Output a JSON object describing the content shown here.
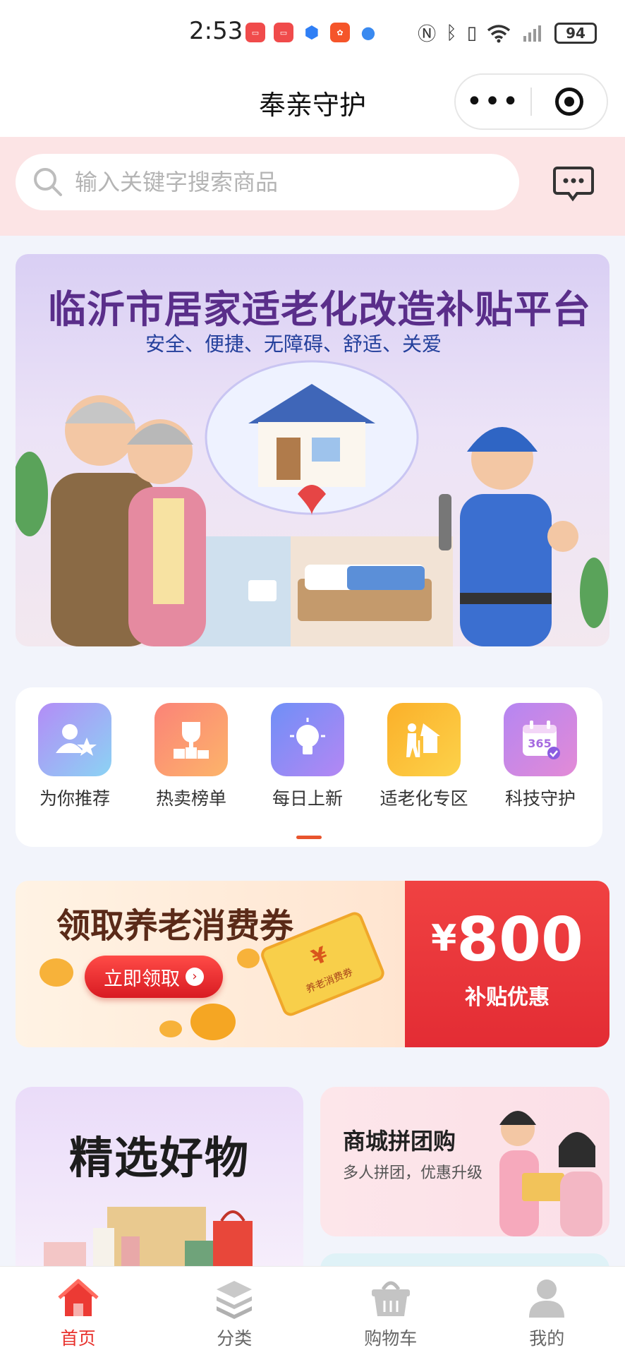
{
  "status_bar": {
    "time": "2:53",
    "battery": "94"
  },
  "nav": {
    "title": "奉亲守护",
    "more_label": "•••"
  },
  "search": {
    "placeholder": "输入关键字搜索商品"
  },
  "banner": {
    "title": "临沂市居家适老化改造补贴平台",
    "subtitle": "安全、便捷、无障碍、舒适、关爱"
  },
  "categories": [
    {
      "label": "为你推荐",
      "icon": "user-star-icon",
      "color": "#b48cf5"
    },
    {
      "label": "热卖榜单",
      "icon": "trophy-icon",
      "color": "#fb7f6f"
    },
    {
      "label": "每日上新",
      "icon": "lightbulb-icon",
      "color": "#7a8af8"
    },
    {
      "label": "适老化专区",
      "icon": "elder-house-icon",
      "color": "#fbb02a"
    },
    {
      "label": "科技守护",
      "icon": "calendar-365-icon",
      "color": "#c383ec"
    }
  ],
  "voucher": {
    "title": "领取养老消费券",
    "button_label": "立即领取",
    "ticket_text": "养老消费券",
    "amount": "800",
    "currency": "¥",
    "subtitle": "补贴优惠"
  },
  "cards": {
    "left_title": "精选好物",
    "right_title": "商城拼团购",
    "right_subtitle": "多人拼团，优惠升级"
  },
  "tabs": [
    {
      "label": "首页",
      "icon": "home-icon",
      "active": true
    },
    {
      "label": "分类",
      "icon": "layers-icon",
      "active": false
    },
    {
      "label": "购物车",
      "icon": "cart-basket-icon",
      "active": false
    },
    {
      "label": "我的",
      "icon": "person-icon",
      "active": false
    }
  ],
  "colors": {
    "accent": "#e8322d",
    "voucher_red": "#ef3c3f",
    "search_band": "#fce4e5"
  }
}
